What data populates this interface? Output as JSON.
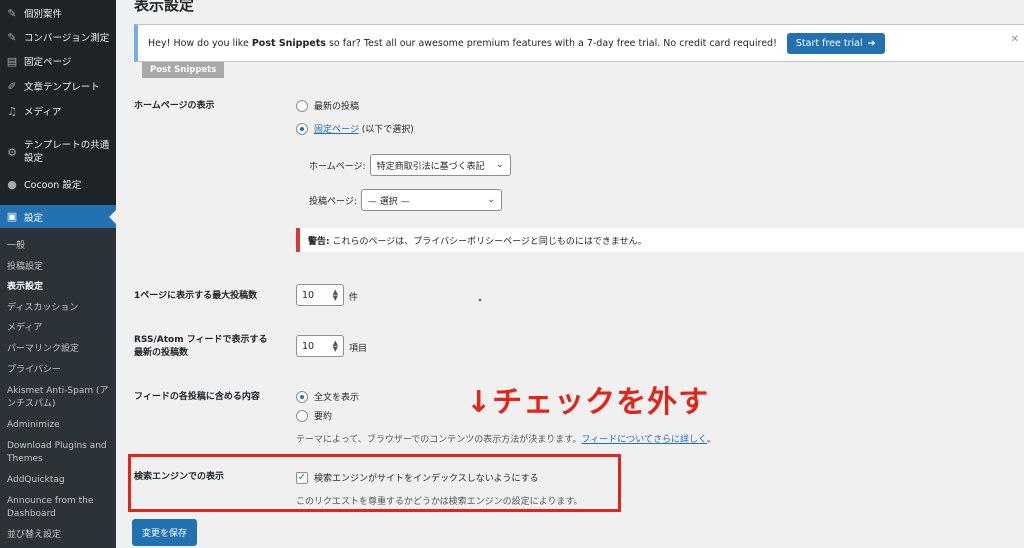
{
  "sidebar": {
    "menu": [
      {
        "label": "個別案件",
        "icon": "pin-icon"
      },
      {
        "label": "コンバージョン測定",
        "icon": "pin-icon"
      },
      {
        "label": "固定ページ",
        "icon": "pages-icon"
      },
      {
        "label": "文章テンプレート",
        "icon": "pencil-icon"
      },
      {
        "label": "メディア",
        "icon": "media-icon"
      },
      {
        "label": "テンプレートの共通設定",
        "icon": "gear-icon"
      },
      {
        "label": "Cocoon 設定",
        "icon": "circle-icon"
      },
      {
        "label": "設定",
        "icon": "settings-icon"
      }
    ],
    "submenu": [
      "一般",
      "投稿設定",
      "表示設定",
      "ディスカッション",
      "メディア",
      "パーマリンク設定",
      "プライバシー",
      "Akismet Anti-Spam (アンチスパム)",
      "Adminimize",
      "Download Plugins and Themes",
      "AddQuicktag",
      "Announce from the Dashboard",
      "並び替え設定"
    ]
  },
  "page": {
    "title": "表示設定"
  },
  "notice": {
    "text_before": "Hey! How do you like ",
    "product": "Post Snippets",
    "text_after": " so far? Test all our awesome premium features with a 7-day free trial. No credit card required!",
    "button": "Start free trial",
    "dismiss": "✕",
    "tag": "Post Snippets"
  },
  "homepage": {
    "label": "ホームページの表示",
    "option_latest": "最新の投稿",
    "option_static_link": "固定ページ",
    "option_static_suffix": " (以下で選択)",
    "home_label": "ホームページ:",
    "home_value": "特定商取引法に基づく表記",
    "posts_label": "投稿ページ:",
    "posts_value": "— 選択 —",
    "warning_bold": "警告:",
    "warning_text": " これらのページは、プライバシーポリシーページと同じものにはできません。"
  },
  "posts_per_page": {
    "label": "1ページに表示する最大投稿数",
    "value": "10",
    "unit": "件"
  },
  "rss": {
    "label_line1": "RSS/Atom フィードで表示する",
    "label_line2": "最新の投稿数",
    "value": "10",
    "unit": "項目"
  },
  "feed": {
    "label": "フィードの各投稿に含める内容",
    "option_full": "全文を表示",
    "option_summary": "要約",
    "desc_text": "テーマによって、ブラウザーでのコンテンツの表示方法が決まります。",
    "desc_link": "フィードについてさらに詳しく",
    "desc_end": "。"
  },
  "annotation": "↓チェックを外す",
  "search": {
    "label": "検索エンジンでの表示",
    "checkbox_label": "検索エンジンがサイトをインデックスしないようにする",
    "desc": "このリクエストを尊重するかどうかは検索エンジンの設定によります。"
  },
  "save_button": "変更を保存"
}
